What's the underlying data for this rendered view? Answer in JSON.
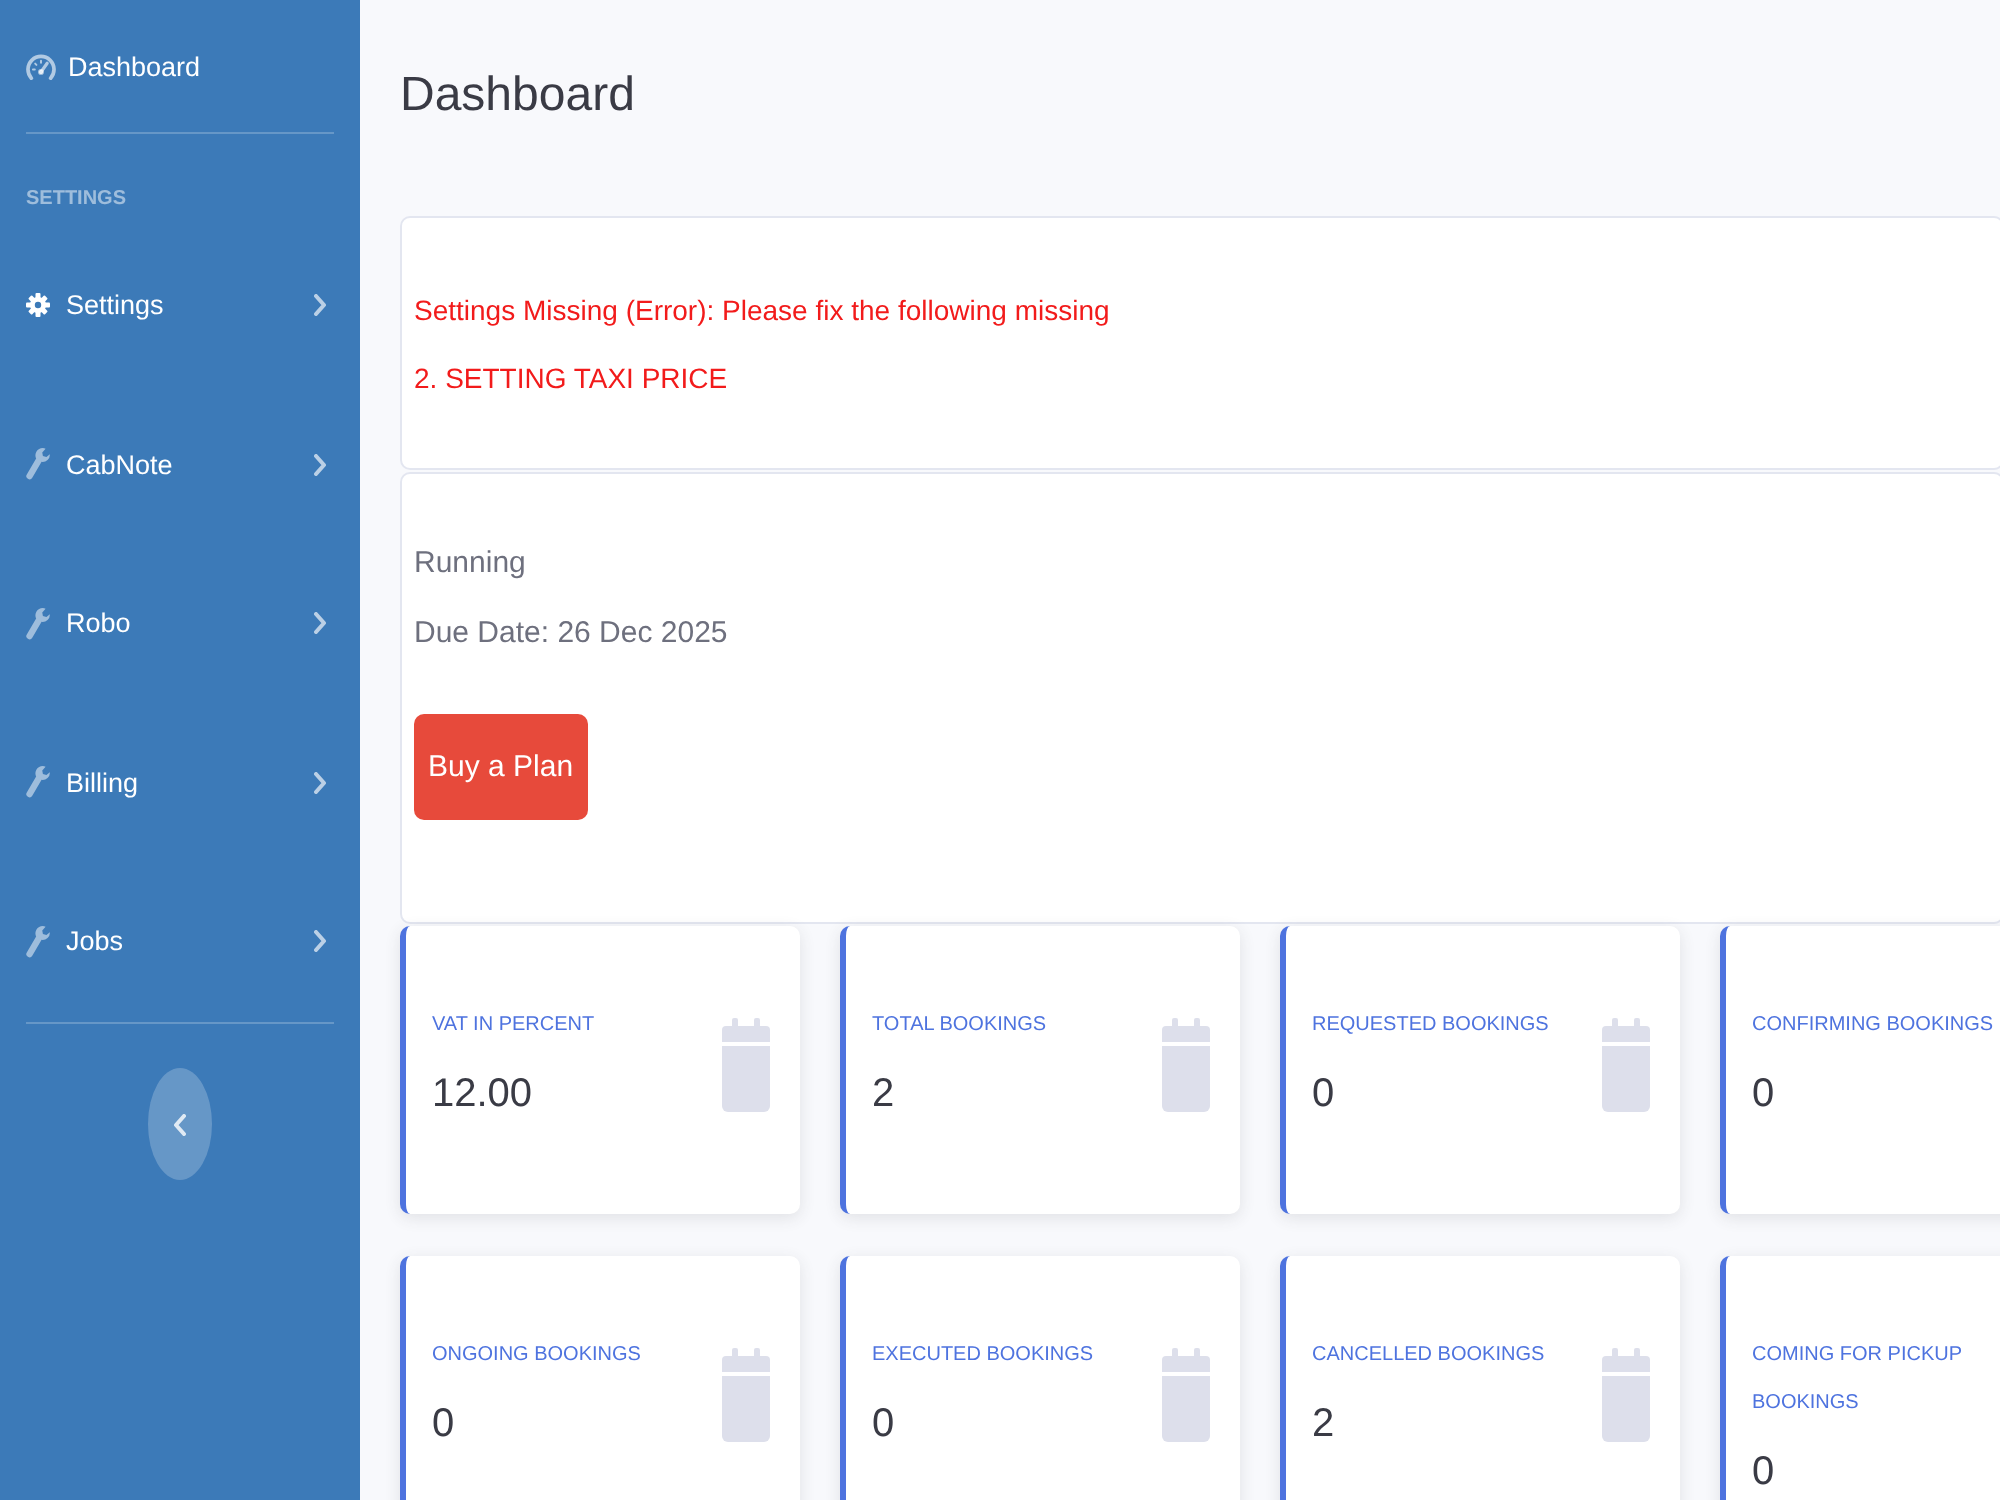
{
  "sidebar": {
    "top_link": {
      "label": "Dashboard"
    },
    "section_heading": "SETTINGS",
    "items": [
      {
        "label": "Settings"
      },
      {
        "label": "CabNote"
      },
      {
        "label": "Robo"
      },
      {
        "label": "Billing"
      },
      {
        "label": "Jobs"
      }
    ]
  },
  "page_title": "Dashboard",
  "alert": {
    "message": "Settings Missing (Error): Please fix the following missing",
    "missing_items": [
      "2. SETTING TAXI PRICE"
    ]
  },
  "subscription": {
    "status": "Running",
    "due_date": "Due Date: 26 Dec 2025",
    "button": "Buy a Plan"
  },
  "stat_cards": [
    {
      "label": "VAT IN PERCENT",
      "value": "12.00"
    },
    {
      "label": "TOTAL BOOKINGS",
      "value": "2"
    },
    {
      "label": "REQUESTED BOOKINGS",
      "value": "0"
    },
    {
      "label": "CONFIRMING BOOKINGS",
      "value": "0"
    },
    {
      "label": "ONGOING BOOKINGS",
      "value": "0"
    },
    {
      "label": "EXECUTED BOOKINGS",
      "value": "0"
    },
    {
      "label": "CANCELLED BOOKINGS",
      "value": "2"
    },
    {
      "label": "COMING FOR PICKUP BOOKINGS",
      "value": "0"
    }
  ]
}
